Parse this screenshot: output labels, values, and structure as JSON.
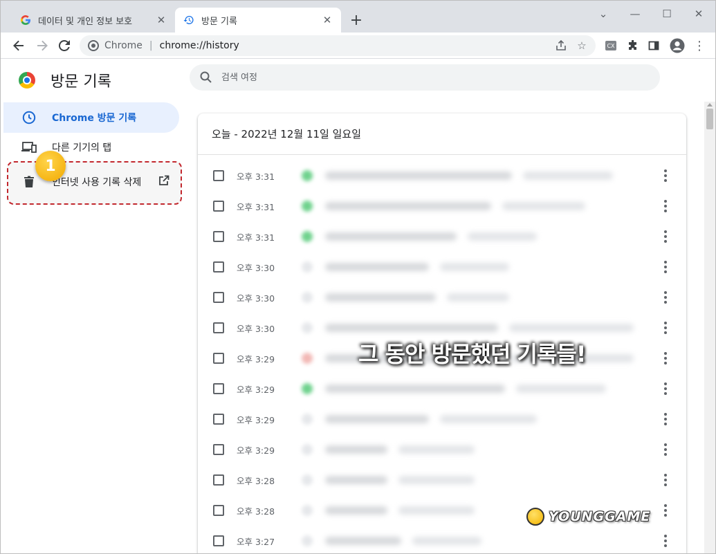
{
  "tabs": [
    {
      "title": "데이터 및 개인 정보 보호",
      "icon": "google-g-icon",
      "active": false
    },
    {
      "title": "방문 기록",
      "icon": "history-icon",
      "active": true
    }
  ],
  "toolbar": {
    "omnibox_site": "Chrome",
    "omnibox_url": "chrome://history"
  },
  "sidebar": {
    "title": "방문 기록",
    "items": [
      {
        "label": "Chrome 방문 기록",
        "icon": "clock-icon",
        "selected": true
      },
      {
        "label": "다른 기기의 탭",
        "icon": "devices-icon",
        "selected": false
      },
      {
        "label": "인터넷 사용 기록 삭제",
        "icon": "trash-icon",
        "selected": false
      }
    ]
  },
  "annotation_badge": "1",
  "search": {
    "placeholder": "검색 여정"
  },
  "history": {
    "date_header": "오늘 - 2022년 12월 11일 일요일",
    "rows": [
      {
        "time": "오후 3:31"
      },
      {
        "time": "오후 3:31"
      },
      {
        "time": "오후 3:31"
      },
      {
        "time": "오후 3:30"
      },
      {
        "time": "오후 3:30"
      },
      {
        "time": "오후 3:30"
      },
      {
        "time": "오후 3:29"
      },
      {
        "time": "오후 3:29"
      },
      {
        "time": "오후 3:29"
      },
      {
        "time": "오후 3:29"
      },
      {
        "time": "오후 3:28"
      },
      {
        "time": "오후 3:28"
      },
      {
        "time": "오후 3:27"
      }
    ]
  },
  "overlay": {
    "caption": "그 동안 방문했던 기록들!",
    "watermark": "YOUNGGAME"
  },
  "colors": {
    "accent": "#1967d2",
    "selected_bg": "#e8f0fe",
    "annotation_red": "#c2272d",
    "badge_yellow": "#f2a900"
  }
}
